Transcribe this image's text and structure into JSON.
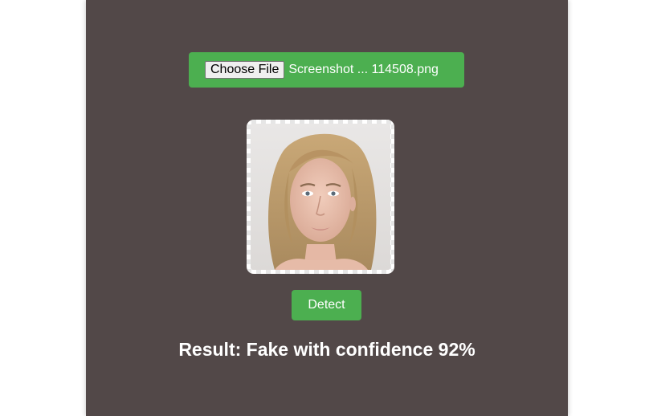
{
  "upload": {
    "button_label": "Choose File",
    "file_name": "Screenshot ... 114508.png"
  },
  "preview": {
    "image_icon": "uploaded-face-photo"
  },
  "actions": {
    "detect_label": "Detect"
  },
  "result": {
    "text": "Result: Fake with confidence 92%"
  },
  "colors": {
    "panel_background": "#524848",
    "accent_green": "#4caf50",
    "page_background": "#ffffff",
    "text_light": "#ffffff"
  }
}
